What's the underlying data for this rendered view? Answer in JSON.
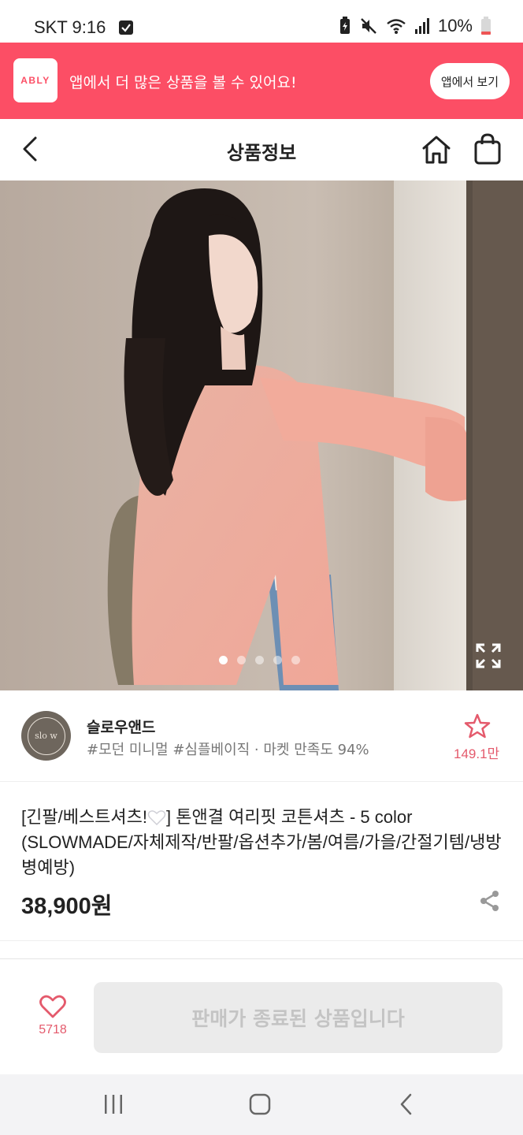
{
  "status_bar": {
    "time": "SKT 9:16",
    "battery": "10%"
  },
  "banner": {
    "logo": "ABLY",
    "message": "앱에서 더 많은 상품을 볼 수 있어요!",
    "button": "앱에서 보기",
    "color": "#fc4e65"
  },
  "header": {
    "title": "상품정보",
    "icons": [
      "back-icon",
      "home-icon",
      "shopping-bag-icon"
    ]
  },
  "gallery": {
    "slide_count": 5,
    "active_index": 0,
    "expand_icon": "expand-icon"
  },
  "store": {
    "name": "슬로우앤드",
    "logo_text": "slo w",
    "tags": "#모던 미니멀 #심플베이직 · 마켓 만족도 94%",
    "favorite_count": "149.1만"
  },
  "product": {
    "title_before_emoji": "[긴팔/베스트셔츠!",
    "title_after_emoji": "] 톤앤결 여리핏 코튼셔츠 - 5 color (SLOWMADE/자체제작/반팔/옵션추가/봄/여름/가을/간절기템/냉방병예방)",
    "emoji": "white-heart",
    "price": "38,900원"
  },
  "bottom_bar": {
    "like_count": "5718",
    "soldout_label": "판매가 종료된 상품입니다"
  },
  "accent_color": "#e45a6c"
}
